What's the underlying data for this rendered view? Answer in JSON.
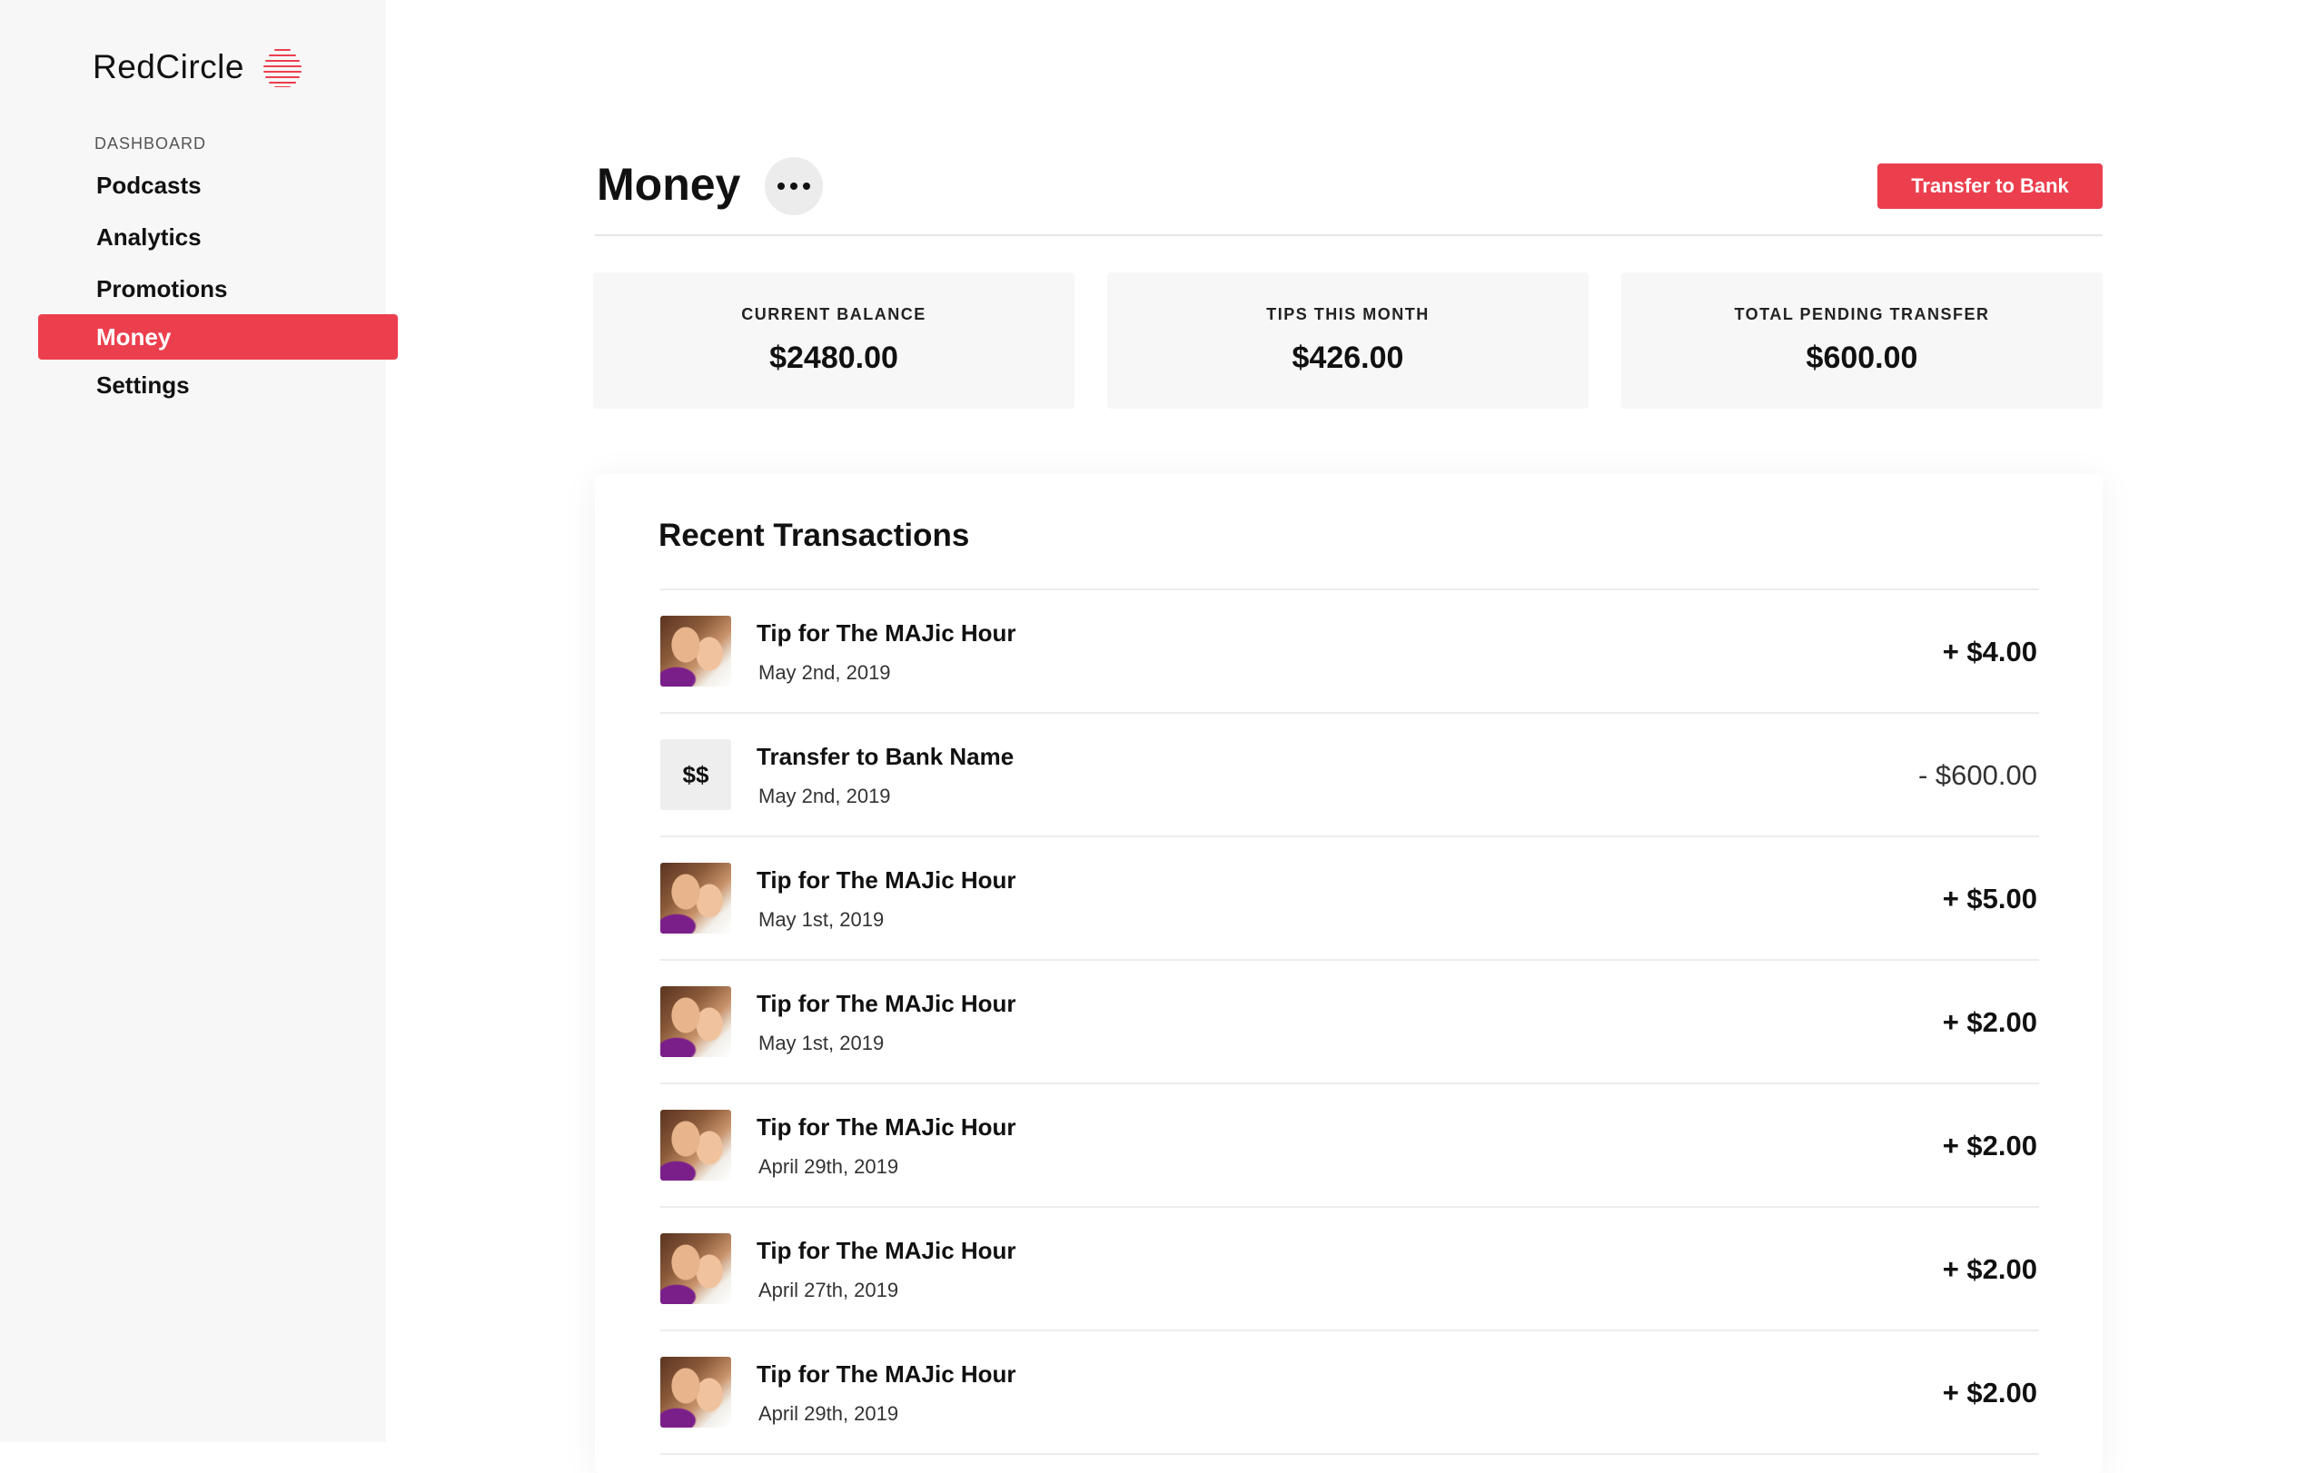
{
  "brand": {
    "name": "RedCircle",
    "logo_icon": "redcircle-logo-icon",
    "accent": "#ec3f4e"
  },
  "sidebar": {
    "section_label": "DASHBOARD",
    "items": [
      {
        "label": "Podcasts",
        "active": false
      },
      {
        "label": "Analytics",
        "active": false
      },
      {
        "label": "Promotions",
        "active": false
      },
      {
        "label": "Money",
        "active": true
      },
      {
        "label": "Settings",
        "active": false
      }
    ]
  },
  "header": {
    "title": "Money",
    "more_icon": "more-horizontal-icon",
    "transfer_label": "Transfer to Bank"
  },
  "stats": [
    {
      "label": "CURRENT BALANCE",
      "value": "$2480.00"
    },
    {
      "label": "TIPS THIS MONTH",
      "value": "$426.00"
    },
    {
      "label": "TOTAL PENDING TRANSFER",
      "value": "$600.00"
    }
  ],
  "transactions": {
    "title": "Recent Transactions",
    "rows": [
      {
        "name": "Tip for The MAJic Hour",
        "date": "May 2nd, 2019",
        "amount": "+ $4.00",
        "kind": "tip"
      },
      {
        "name": "Transfer to Bank Name",
        "date": "May 2nd, 2019",
        "amount": "- $600.00",
        "kind": "transfer",
        "thumb_text": "$$"
      },
      {
        "name": "Tip for The MAJic Hour",
        "date": "May 1st, 2019",
        "amount": "+ $5.00",
        "kind": "tip"
      },
      {
        "name": "Tip for The MAJic Hour",
        "date": "May 1st, 2019",
        "amount": "+ $2.00",
        "kind": "tip"
      },
      {
        "name": "Tip for The MAJic Hour",
        "date": "April 29th, 2019",
        "amount": "+ $2.00",
        "kind": "tip"
      },
      {
        "name": "Tip for The MAJic Hour",
        "date": "April 27th, 2019",
        "amount": "+ $2.00",
        "kind": "tip"
      },
      {
        "name": "Tip for The MAJic Hour",
        "date": "April 29th, 2019",
        "amount": "+ $2.00",
        "kind": "tip"
      }
    ]
  }
}
